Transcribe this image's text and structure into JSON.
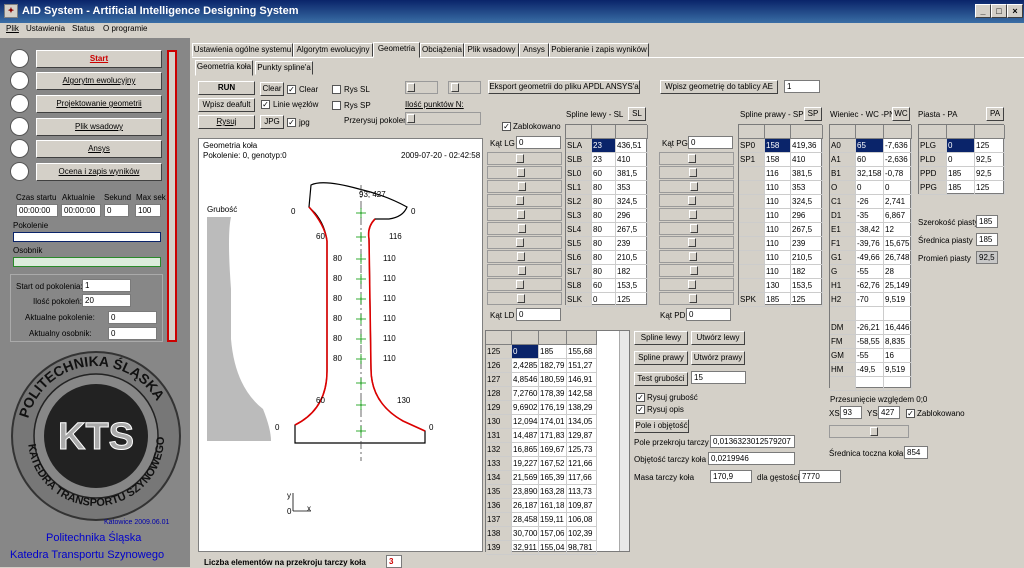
{
  "window": {
    "title": "AID System - Artificial Intelligence Designing System"
  },
  "menu": [
    "Plik",
    "Ustawienia",
    "Status",
    "O programie"
  ],
  "left": {
    "buttons": [
      "Start",
      "Algorytm ewolucyjny",
      "Projektowanie geometrii",
      "Plik wsadowy",
      "Ansys",
      "Ocena i zapis wyników"
    ],
    "time_headers": [
      "Czas startu",
      "Aktualnie",
      "Sekund",
      "Max sek"
    ],
    "time_values": [
      "00:00:00",
      "00:00:00",
      "0",
      "100"
    ],
    "pokolenie": "Pokolenie",
    "osobnik": "Osobnik",
    "start_label": "Start od pokolenia:",
    "start_val": "1",
    "ilosc_label": "Ilość pokoleń:",
    "ilosc_val": "20",
    "akt_pok_label": "Aktualne pokolenie:",
    "akt_pok_val": "0",
    "akt_os_label": "Aktualny osobnik:",
    "akt_os_val": "0",
    "logo_text": "KTS",
    "ring_top": "POLITECHNIKA ŚLĄSKA",
    "ring_bottom": "KATEDRA TRANSPORTU SZYNOWEGO",
    "place_date": "Katowice 2009.06.01",
    "univ": "Politechnika Śląska",
    "dept": "Katedra Transportu Szynowego"
  },
  "tabs": [
    "Ustawienia ogólne systemu",
    "Algorytm ewolucyjny",
    "Geometria",
    "Obciążenia",
    "Plik wsadowy",
    "Ansys",
    "Pobieranie i zapis wyników"
  ],
  "subtabs": [
    "Geometria koła",
    "Punkty spline'a"
  ],
  "controls": {
    "run": "RUN",
    "wpisz": "Wpisz deafult",
    "rysuj": "Rysuj",
    "clear1": "Clear",
    "clear2": "Clear",
    "linie": "Linie węzłów",
    "jpg": "JPG",
    "jpg2": "jpg",
    "rys_sl": "Rys SL",
    "rys_sp": "Rys SP",
    "ilosc_pkt": "Ilość punktów N:",
    "przerysuj": "Przerysuj pokolenie"
  },
  "export_btn": "Eksport geometrii do pliku APDL ANSYS'a",
  "wpisz_ae": "Wpisz geometrię do tablicy AE",
  "wpisz_ae_val": "1",
  "geo": {
    "title": "Geometria koła",
    "info": "Pokolenie: 0, genotyp:0",
    "date": "2009-07-20 - 02:42:58",
    "grubosc": "Grubość",
    "top_label": "93; 427",
    "left_vals": [
      "0",
      "60",
      "80",
      "80",
      "80",
      "80",
      "80",
      "80",
      "60",
      "0"
    ],
    "right_vals": [
      "0",
      "116",
      "110",
      "110",
      "110",
      "110",
      "110",
      "110",
      "130",
      "0"
    ],
    "axis_y": "y",
    "axis_x": "x",
    "axis_0": "0"
  },
  "zablok": "Zablokowano",
  "kat": {
    "lg": "Kąt LG",
    "lg_val": "0",
    "pg": "Kąt PG",
    "pg_val": "0",
    "ld": "Kąt LD",
    "ld_val": "0",
    "pd": "Kąt PD",
    "pd_val": "0"
  },
  "spline_left": {
    "title": "Spline lewy - SL",
    "btn": "SL",
    "rows": [
      [
        "SLA",
        "23",
        "436,51"
      ],
      [
        "SLB",
        "23",
        "410"
      ],
      [
        "SL0",
        "60",
        "381,5"
      ],
      [
        "SL1",
        "80",
        "353"
      ],
      [
        "SL2",
        "80",
        "324,5"
      ],
      [
        "SL3",
        "80",
        "296"
      ],
      [
        "SL4",
        "80",
        "267,5"
      ],
      [
        "SL5",
        "80",
        "239"
      ],
      [
        "SL6",
        "80",
        "210,5"
      ],
      [
        "SL7",
        "80",
        "182"
      ],
      [
        "SL8",
        "60",
        "153,5"
      ],
      [
        "SLK",
        "0",
        "125"
      ]
    ]
  },
  "spline_right": {
    "title": "Spline prawy - SP",
    "btn": "SP",
    "rows": [
      [
        "SP0",
        "158",
        "419,36"
      ],
      [
        "SP1",
        "158",
        "410"
      ],
      [
        "",
        "116",
        "381,5"
      ],
      [
        "",
        "110",
        "353"
      ],
      [
        "",
        "110",
        "324,5"
      ],
      [
        "",
        "110",
        "296"
      ],
      [
        "",
        "110",
        "267,5"
      ],
      [
        "",
        "110",
        "239"
      ],
      [
        "",
        "110",
        "210,5"
      ],
      [
        "",
        "110",
        "182"
      ],
      [
        "",
        "130",
        "153,5"
      ],
      [
        "SPK",
        "185",
        "125"
      ]
    ]
  },
  "wieniec": {
    "title": "Wieniec - WC -PN",
    "btn": "WC",
    "rows": [
      [
        "A0",
        "65",
        "-7,636"
      ],
      [
        "A1",
        "60",
        "-2,636"
      ],
      [
        "B1",
        "32,158",
        "-0,78"
      ],
      [
        "O",
        "0",
        "0"
      ],
      [
        "C1",
        "-26",
        "2,741"
      ],
      [
        "D1",
        "-35",
        "6,867"
      ],
      [
        "E1",
        "-38,42",
        "12"
      ],
      [
        "F1",
        "-39,76",
        "15,675"
      ],
      [
        "G1",
        "-49,66",
        "26,748"
      ],
      [
        "G",
        "-55",
        "28"
      ],
      [
        "H1",
        "-62,76",
        "25,149"
      ],
      [
        "H2",
        "-70",
        "9,519"
      ],
      [
        "",
        "",
        ""
      ],
      [
        "DM",
        "-26,21",
        "16,446"
      ],
      [
        "FM",
        "-58,55",
        "8,835"
      ],
      [
        "GM",
        "-55",
        "16"
      ],
      [
        "HM",
        "-49,5",
        "9,519"
      ],
      [
        "",
        "",
        ""
      ]
    ]
  },
  "piasta": {
    "title": "Piasta - PA",
    "btn": "PA",
    "rows": [
      [
        "PLG",
        "0",
        "125"
      ],
      [
        "PLD",
        "0",
        "92,5"
      ],
      [
        "PPD",
        "185",
        "92,5"
      ],
      [
        "PPG",
        "185",
        "125"
      ]
    ],
    "szer_label": "Szerokość piasty",
    "szer_val": "185",
    "sred_label": "Średnica piasty",
    "sred_val": "185",
    "prom_label": "Promień piasty",
    "prom_val": "92,5"
  },
  "nodes": {
    "rows": [
      [
        "125",
        "0",
        "185",
        "155,68"
      ],
      [
        "126",
        "2,4285",
        "182,79",
        "151,27"
      ],
      [
        "127",
        "4,8546",
        "180,59",
        "146,91"
      ],
      [
        "128",
        "7,2760",
        "178,39",
        "142,58"
      ],
      [
        "129",
        "9,6902",
        "176,19",
        "138,29"
      ],
      [
        "130",
        "12,094",
        "174,01",
        "134,05"
      ],
      [
        "131",
        "14,487",
        "171,83",
        "129,87"
      ],
      [
        "132",
        "16,865",
        "169,67",
        "125,73"
      ],
      [
        "133",
        "19,227",
        "167,52",
        "121,66"
      ],
      [
        "134",
        "21,569",
        "165,39",
        "117,66"
      ],
      [
        "135",
        "23,890",
        "163,28",
        "113,73"
      ],
      [
        "136",
        "26,187",
        "161,18",
        "109,87"
      ],
      [
        "137",
        "28,458",
        "159,11",
        "106,08"
      ],
      [
        "138",
        "30,700",
        "157,06",
        "102,39"
      ],
      [
        "139",
        "32,911",
        "155,04",
        "98,781"
      ]
    ]
  },
  "right_ctrl": {
    "spline_lewy": "Spline lewy",
    "utworz_lewy": "Utwórz lewy",
    "spline_prawy": "Spline prawy",
    "utworz_prawy": "Utwórz prawy",
    "test": "Test grubości",
    "test_val": "15",
    "rys_grub": "Rysuj grubość",
    "rys_opis": "Rysuj opis",
    "pole_btn": "Pole i objętość",
    "pole_label": "Pole przekroju tarczy",
    "pole_val": "0,0136323012579207",
    "obj_label": "Objętość tarczy koła",
    "obj_val": "0,0219946",
    "masa_label": "Masa tarczy koła",
    "masa_val": "170,9",
    "gest_label": "dla gęstości",
    "gest_val": "7770"
  },
  "przes": {
    "label": "Przesunięcie względem 0;0",
    "xs": "XS",
    "xs_val": "93",
    "ys": "YS",
    "ys_val": "427",
    "zab": "Zablokowano",
    "sred_label": "Średnica toczna koła",
    "sred_val": "854"
  },
  "bottom": {
    "label": "Liczba elementów na przekroju tarczy koła",
    "val": "3"
  }
}
